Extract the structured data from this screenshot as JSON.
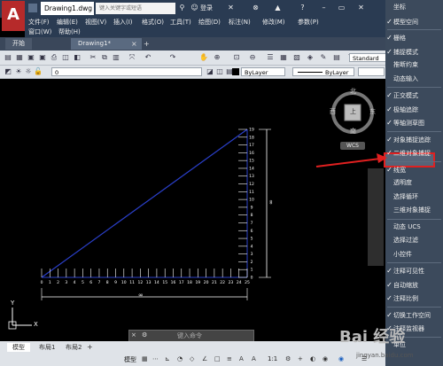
{
  "app": {
    "title": "Drawing1.dwg",
    "search_placeholder": "键入关键字或短语",
    "login_label": "登录"
  },
  "menubar": {
    "row1": [
      "文件(F)",
      "编辑(E)",
      "视图(V)",
      "插入(I)",
      "格式(O)",
      "工具(T)",
      "绘图(D)",
      "标注(N)",
      "修改(M)",
      "参数(P)"
    ],
    "row2": [
      "窗口(W)",
      "帮助(H)"
    ]
  },
  "doc_tabs": [
    "开始",
    "Drawing1*"
  ],
  "toolbar": {
    "layer_value": "0",
    "color_value": "ByLayer",
    "linetype_value": "ByLayer",
    "style_value": "Standard"
  },
  "viewcube": {
    "north": "北",
    "south": "南",
    "east": "东",
    "west": "西",
    "top": "上",
    "wcs": "WCS"
  },
  "ucs_labels": {
    "y": "Y",
    "x": "X"
  },
  "layout_tabs": [
    "模型",
    "布局1",
    "布局2"
  ],
  "status_bar": {
    "model_label": "模型",
    "command_placeholder": "键入命令",
    "scale": "1:1"
  },
  "context_menu": {
    "items": [
      {
        "label": "坐标",
        "checked": false
      },
      {
        "label": "模型空间",
        "checked": true
      },
      {
        "label": "栅格",
        "checked": true
      },
      {
        "label": "捕捉模式",
        "checked": true
      },
      {
        "label": "推断约束",
        "checked": false
      },
      {
        "label": "动态输入",
        "checked": false
      },
      {
        "label": "正交模式",
        "checked": true
      },
      {
        "label": "极轴追踪",
        "checked": true
      },
      {
        "label": "等轴测草图",
        "checked": true
      },
      {
        "label": "对象捕捉追踪",
        "checked": true
      },
      {
        "label": "二维对象捕捉",
        "checked": true
      },
      {
        "label": "线宽",
        "checked": true
      },
      {
        "label": "透明度",
        "checked": false
      },
      {
        "label": "选择循环",
        "checked": false
      },
      {
        "label": "三维对象捕捉",
        "checked": false
      },
      {
        "label": "动态 UCS",
        "checked": false
      },
      {
        "label": "选择过滤",
        "checked": false
      },
      {
        "label": "小控件",
        "checked": false
      },
      {
        "label": "注释可见性",
        "checked": true
      },
      {
        "label": "自动缩放",
        "checked": true
      },
      {
        "label": "注释比例",
        "checked": true
      },
      {
        "label": "切换工作空间",
        "checked": true
      },
      {
        "label": "注释监视器",
        "checked": true
      },
      {
        "label": "单位",
        "checked": false
      }
    ]
  },
  "drawing": {
    "bottom_ticks": [
      "0",
      "1",
      "2",
      "3",
      "4",
      "5",
      "6",
      "7",
      "8",
      "9",
      "10",
      "11",
      "12",
      "13",
      "14",
      "15",
      "16",
      "17",
      "18",
      "19",
      "20",
      "21",
      "22",
      "23",
      "24",
      "25"
    ],
    "right_ticks": [
      "0",
      "1",
      "2",
      "3",
      "4",
      "5",
      "6",
      "7",
      "8",
      "9",
      "10",
      "11",
      "12",
      "13",
      "14",
      "15",
      "16",
      "17",
      "18",
      "19"
    ],
    "bottom_dim": "∞",
    "right_dim": "∞"
  },
  "watermark": {
    "text": "Bai 经验",
    "url": "jingyan.baidu.com"
  }
}
